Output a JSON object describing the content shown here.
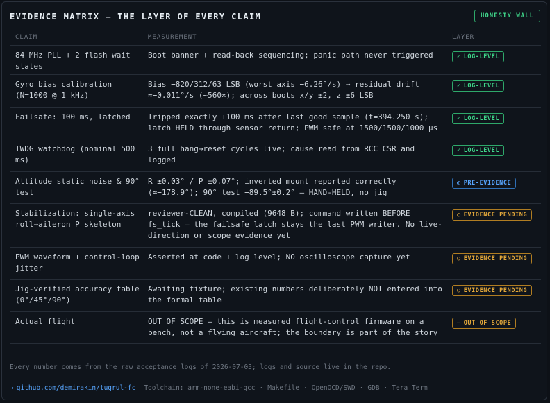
{
  "header": {
    "title": "EVIDENCE MATRIX — THE LAYER OF EVERY CLAIM",
    "badge": "HONESTY WALL"
  },
  "columns": {
    "claim": "CLAIM",
    "measurement": "MEASUREMENT",
    "layer": "LAYER"
  },
  "rows": [
    {
      "claim": "84 MHz PLL + 2 flash wait states",
      "measurement": "Boot banner + read-back sequencing; panic path never triggered",
      "layer": {
        "icon": "✓",
        "icon_name": "check-icon",
        "label": "LOG-LEVEL",
        "color": "#3fd68a"
      }
    },
    {
      "claim": "Gyro bias calibration (N=1000 @ 1 kHz)",
      "measurement": "Bias −820/312/63 LSB (worst axis −6.26°/s) → residual drift ≈−0.011°/s (~560×); across boots x/y ±2, z ±6 LSB",
      "layer": {
        "icon": "✓",
        "icon_name": "check-icon",
        "label": "LOG-LEVEL",
        "color": "#3fd68a"
      }
    },
    {
      "claim": "Failsafe: 100 ms, latched",
      "measurement": "Tripped exactly +100 ms after last good sample (t=394.250 s); latch HELD through sensor return; PWM safe at 1500/1500/1000 µs",
      "layer": {
        "icon": "✓",
        "icon_name": "check-icon",
        "label": "LOG-LEVEL",
        "color": "#3fd68a"
      }
    },
    {
      "claim": "IWDG watchdog (nominal 500 ms)",
      "measurement": "3 full hang→reset cycles live; cause read from RCC_CSR and logged",
      "layer": {
        "icon": "✓",
        "icon_name": "check-icon",
        "label": "LOG-LEVEL",
        "color": "#3fd68a"
      }
    },
    {
      "claim": "Attitude static noise & 90° test",
      "measurement": "R ±0.03° / P ±0.07°; inverted mount reported correctly (≈−178.9°); 90° test −89.5°±0.2° — HAND-HELD, no jig",
      "layer": {
        "icon": "◐",
        "icon_name": "half-circle-icon",
        "label": "PRE-EVIDENCE",
        "color": "#58a6ff"
      }
    },
    {
      "claim": "Stabilization: single-axis roll→aileron P skeleton",
      "measurement": "reviewer-CLEAN, compiled (9648 B); command written BEFORE fs_tick — the failsafe latch stays the last PWM writer. No live-direction or scope evidence yet",
      "layer": {
        "icon": "○",
        "icon_name": "circle-icon",
        "label": "EVIDENCE PENDING",
        "color": "#e3a83a"
      }
    },
    {
      "claim": "PWM waveform + control-loop jitter",
      "measurement": "Asserted at code + log level; NO oscilloscope capture yet",
      "layer": {
        "icon": "○",
        "icon_name": "circle-icon",
        "label": "EVIDENCE PENDING",
        "color": "#e3a83a"
      }
    },
    {
      "claim": "Jig-verified accuracy table (0°/45°/90°)",
      "measurement": "Awaiting fixture; existing numbers deliberately NOT entered into the formal table",
      "layer": {
        "icon": "○",
        "icon_name": "circle-icon",
        "label": "EVIDENCE PENDING",
        "color": "#e3a83a"
      }
    },
    {
      "claim": "Actual flight",
      "measurement": "OUT OF SCOPE — this is measured flight-control firmware on a bench, not a flying aircraft; the boundary is part of the story",
      "layer": {
        "icon": "—",
        "icon_name": "dash-icon",
        "label": "OUT OF SCOPE",
        "color": "#e3a83a"
      }
    }
  ],
  "footer": {
    "note": "Every number comes from the raw acceptance logs of 2026-07-03; logs and source live in the repo.",
    "arrow": "→",
    "repo_link": "github.com/demirakin/tugrul-fc",
    "toolchain_label": "Toolchain: arm-none-eabi-gcc",
    "tools": [
      "Makefile",
      "OpenOCD/SWD",
      "GDB",
      "Tera Term"
    ],
    "separator": "·"
  }
}
